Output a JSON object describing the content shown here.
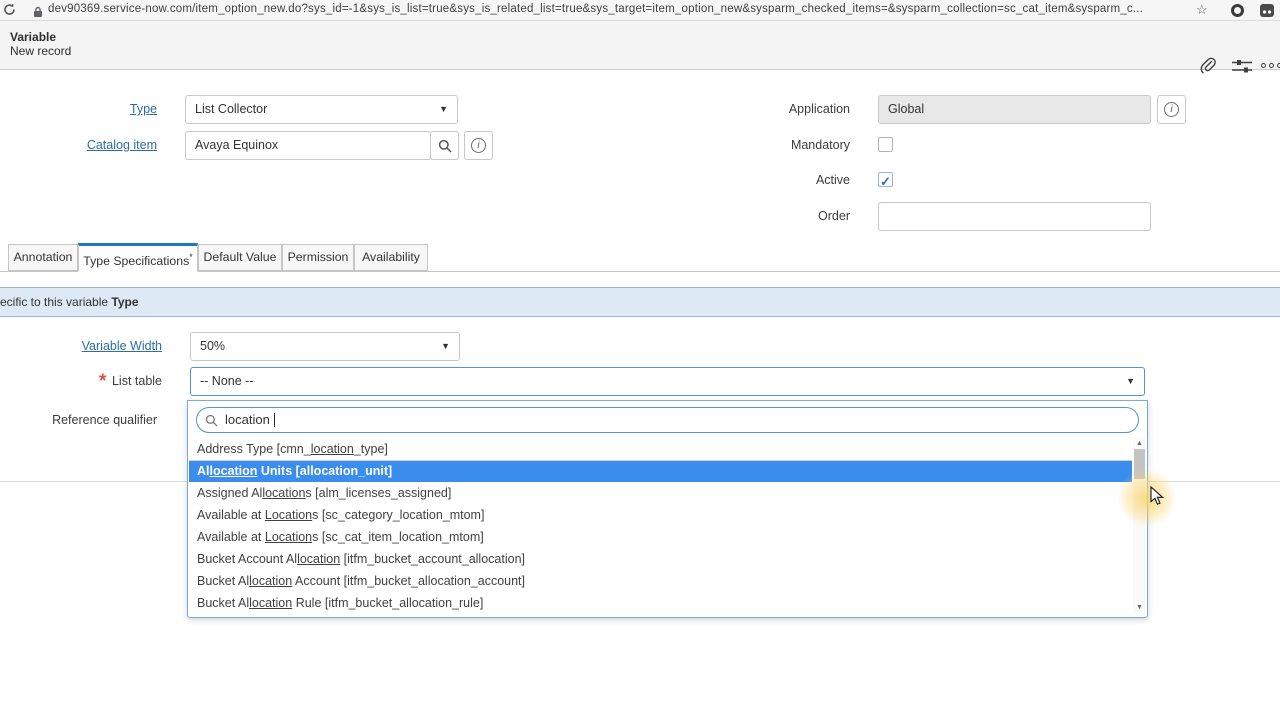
{
  "browser": {
    "url": "dev90369.service-now.com/item_option_new.do?sys_id=-1&sys_is_list=true&sys_is_related_list=true&sys_target=item_option_new&sysparm_checked_items=&sysparm_collection=sc_cat_item&sysparm_c...",
    "star_glyph": "☆"
  },
  "header": {
    "title": "Variable",
    "subtitle": "New record"
  },
  "form": {
    "type_label": "Type",
    "type_value": "List Collector",
    "catalog_label": "Catalog item",
    "catalog_value": "Avaya Equinox",
    "application_label": "Application",
    "application_value": "Global",
    "mandatory_label": "Mandatory",
    "active_label": "Active",
    "order_label": "Order",
    "order_value": ""
  },
  "tabs": [
    {
      "label": "Annotation",
      "active": false
    },
    {
      "label": "Type Specifications",
      "mark": "*",
      "active": true
    },
    {
      "label": "Default Value",
      "active": false
    },
    {
      "label": "Permission",
      "active": false
    },
    {
      "label": "Availability",
      "active": false
    }
  ],
  "section_bar": {
    "prefix": "ecific to this variable ",
    "bold": "Type"
  },
  "type_spec": {
    "variable_width_label": "Variable Width",
    "variable_width_value": "50%",
    "list_table_label": "List table",
    "list_table_value": "-- None --",
    "mandatory_star": "*",
    "reference_qualifier_label": "Reference qualifier"
  },
  "dropdown": {
    "search_value": "location",
    "items": [
      {
        "text": "Address Type [cmn_location_type]",
        "selected": false
      },
      {
        "text": "Allocation Units [allocation_unit]",
        "selected": true
      },
      {
        "text": "Assigned Allocations [alm_licenses_assigned]",
        "selected": false
      },
      {
        "text": "Available at Locations [sc_category_location_mtom]",
        "selected": false
      },
      {
        "text": "Available at Locations [sc_cat_item_location_mtom]",
        "selected": false
      },
      {
        "text": "Bucket Account Allocation [itfm_bucket_account_allocation]",
        "selected": false
      },
      {
        "text": "Bucket Allocation Account [itfm_bucket_allocation_account]",
        "selected": false
      },
      {
        "text": "Bucket Allocation Rule [itfm_bucket_allocation_rule]",
        "selected": false
      }
    ]
  },
  "icons": {
    "caret": "▼",
    "check": "✓",
    "scroll_up": "▲",
    "scroll_down": "▼"
  },
  "colors": {
    "selected_row": "#3b8ded",
    "tab_active_accent": "#2179bd",
    "label_link": "#2a6ea6",
    "mandatory_red": "#d9534f",
    "section_bar_bg": "#dde9f4"
  }
}
